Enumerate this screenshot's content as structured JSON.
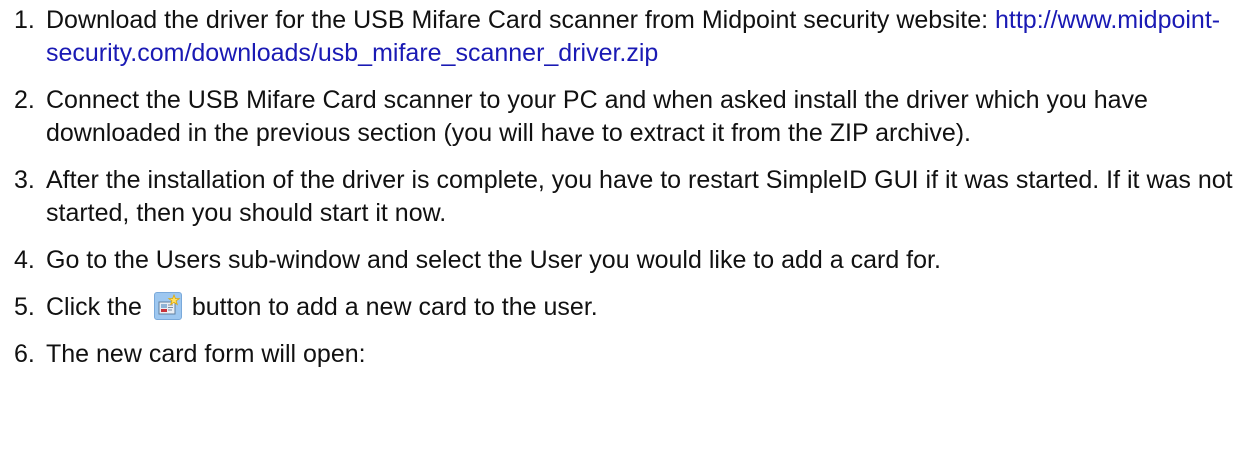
{
  "steps": [
    {
      "number": "1.",
      "text": "Download the driver for the USB Mifare Card scanner from Midpoint security website:",
      "link": "http://www.midpoint-security.com/downloads/usb_mifare_scanner_driver.zip"
    },
    {
      "number": "2.",
      "text": "Connect the USB Mifare Card scanner to your PC and when asked install the driver which you have downloaded in the previous section (you will have to extract it from the ZIP archive)."
    },
    {
      "number": "3.",
      "text": "After the installation of the driver is complete, you have to restart SimpleID GUI if it was started. If it was not started, then you should start it now."
    },
    {
      "number": "4.",
      "text": "Go to the Users sub-window and select the User you would like to add a card for."
    },
    {
      "number": "5.",
      "text_before": "Click the",
      "icon": "add-card-icon",
      "text_after": "button to add a new card to the user."
    },
    {
      "number": "6.",
      "text": "The new card form will open:"
    }
  ],
  "colors": {
    "link": "#1a1ab4",
    "text": "#111111"
  }
}
